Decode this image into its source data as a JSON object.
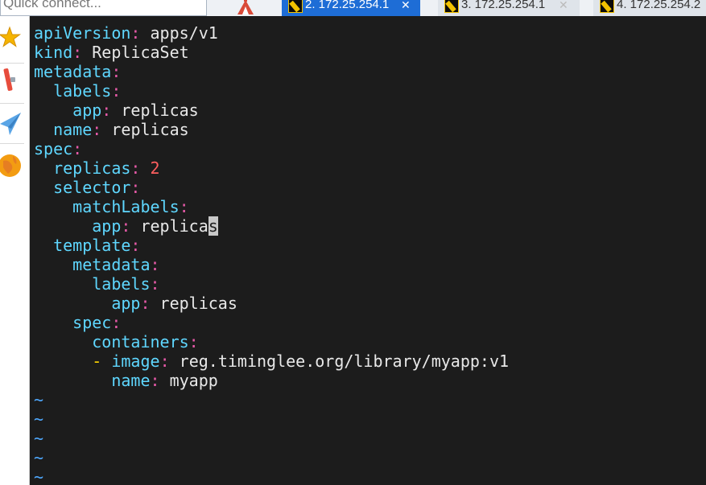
{
  "quick_connect": {
    "placeholder": "Quick connect..."
  },
  "tabs": [
    {
      "label": "2. 172.25.254.1",
      "close": "✕",
      "active": true
    },
    {
      "label": "3. 172.25.254.1",
      "close": "✕",
      "active": false
    },
    {
      "label": "4. 172.25.254.2",
      "close": "",
      "active": false
    }
  ],
  "left_toolbar": [
    {
      "icon": "star-icon"
    },
    {
      "icon": "tools-icon"
    },
    {
      "icon": "paper-plane-icon"
    },
    {
      "icon": "globe-icon"
    }
  ],
  "editor": {
    "lines": [
      {
        "indent": "",
        "key": "apiVersion",
        "value": "apps/v1"
      },
      {
        "indent": "",
        "key": "kind",
        "value": "ReplicaSet"
      },
      {
        "indent": "",
        "key": "metadata",
        "value": ""
      },
      {
        "indent": "  ",
        "key": "labels",
        "value": ""
      },
      {
        "indent": "    ",
        "key": "app",
        "value": "replicas"
      },
      {
        "indent": "  ",
        "key": "name",
        "value": "replicas"
      },
      {
        "indent": "",
        "key": "spec",
        "value": ""
      },
      {
        "indent": "  ",
        "key": "replicas",
        "value": "2"
      },
      {
        "indent": "  ",
        "key": "selector",
        "value": ""
      },
      {
        "indent": "    ",
        "key": "matchLabels",
        "value": ""
      },
      {
        "indent": "      ",
        "key": "app",
        "value": "replica",
        "cursor_char": "s"
      },
      {
        "indent": "  ",
        "key": "template",
        "value": ""
      },
      {
        "indent": "    ",
        "key": "metadata",
        "value": ""
      },
      {
        "indent": "      ",
        "key": "labels",
        "value": ""
      },
      {
        "indent": "        ",
        "key": "app",
        "value": "replicas"
      },
      {
        "indent": "    ",
        "key": "spec",
        "value": ""
      },
      {
        "indent": "      ",
        "key": "containers",
        "value": ""
      },
      {
        "indent": "      ",
        "dash": "-",
        "key": "image",
        "value": "reg.timinglee.org/library/myapp:v1"
      },
      {
        "indent": "        ",
        "key": "name",
        "value": "myapp"
      }
    ],
    "separator": ":",
    "tilde": "~",
    "tilde_count": 5
  },
  "colors": {
    "background": "#1c1c1c",
    "key": "#5fd7ff",
    "punctuation": "#e75aa8",
    "number": "#ff5f5f",
    "dash": "#ffd700",
    "tilde": "#4fa9ff",
    "active_tab": "#1e6dd6"
  }
}
